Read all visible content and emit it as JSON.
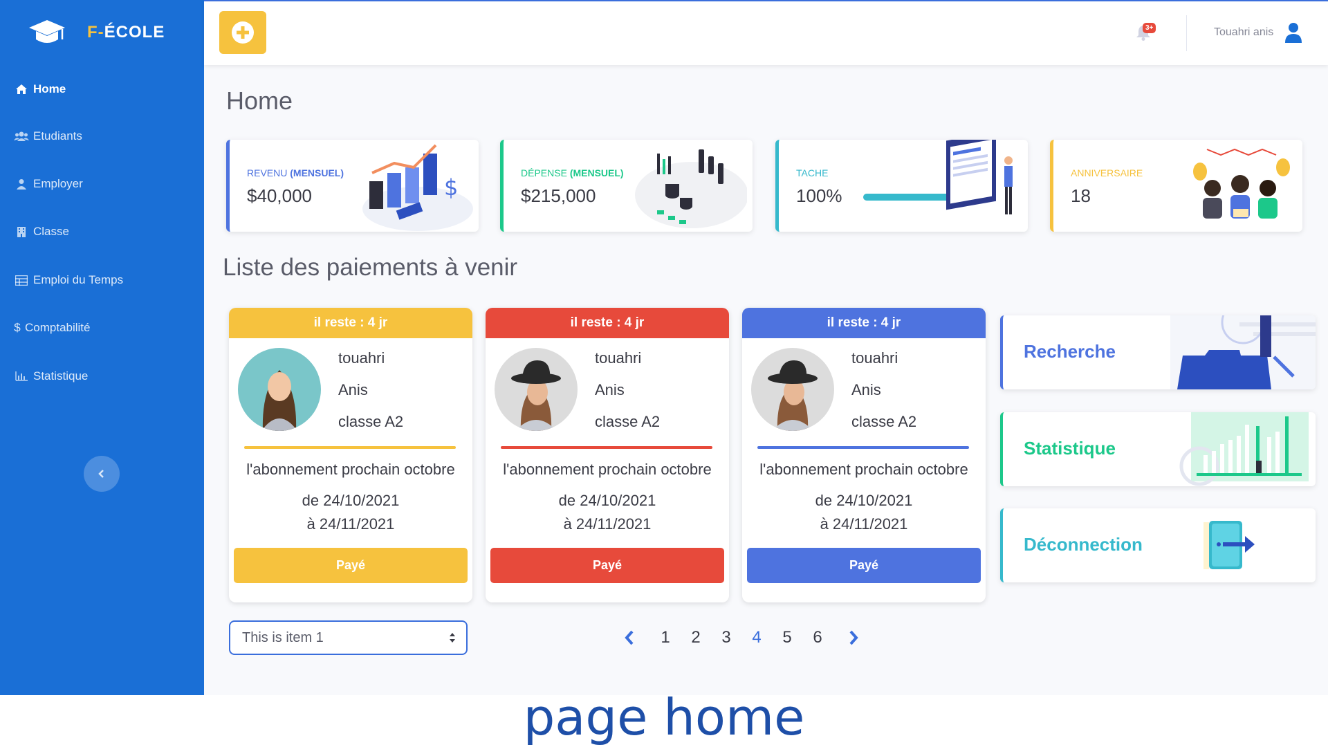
{
  "brand": {
    "prefix": "F-",
    "name": "ÉCOLE"
  },
  "sidebar": {
    "items": [
      {
        "label": "Home",
        "icon": "home-icon",
        "active": true
      },
      {
        "label": "Etudiants",
        "icon": "users-icon"
      },
      {
        "label": "Employer",
        "icon": "user-icon"
      },
      {
        "label": "Classe",
        "icon": "building-icon"
      },
      {
        "label": "Emploi du Temps",
        "icon": "table-icon"
      },
      {
        "label": "Comptabilité",
        "icon": "dollar-icon"
      },
      {
        "label": "Statistique",
        "icon": "chart-icon"
      }
    ]
  },
  "topbar": {
    "notifications_badge": "3+",
    "username": "Touahri anis"
  },
  "page": {
    "title": "Home",
    "section_title": "Liste des paiements à venir"
  },
  "stats": [
    {
      "label": "REVENU",
      "label_bold": "(MENSUEL)",
      "value": "$40,000",
      "color": "#4e73df"
    },
    {
      "label": "DÉPENSE",
      "label_bold": "(MENSUEL)",
      "value": "$215,000",
      "color": "#1cc88a"
    },
    {
      "label": "TACHE",
      "label_bold": "",
      "value": "100%",
      "progress": 1.0,
      "color": "#36b9cc"
    },
    {
      "label": "ANNIVERSAIRE",
      "label_bold": "",
      "value": "18",
      "color": "#f6c23e"
    }
  ],
  "payments": [
    {
      "remaining": "il reste : 4 jr",
      "first": "touahri",
      "last": "Anis",
      "class": "classe A2",
      "sub": "l'abonnement prochain octobre",
      "from": "de 24/10/2021",
      "to": "à 24/11/2021",
      "button": "Payé",
      "color": "#f6c23e"
    },
    {
      "remaining": "il reste : 4 jr",
      "first": "touahri",
      "last": "Anis",
      "class": "classe A2",
      "sub": "l'abonnement prochain octobre",
      "from": "de 24/10/2021",
      "to": "à 24/11/2021",
      "button": "Payé",
      "color": "#e74a3b"
    },
    {
      "remaining": "il reste : 4 jr",
      "first": "touahri",
      "last": "Anis",
      "class": "classe A2",
      "sub": "l'abonnement prochain octobre",
      "from": "de 24/10/2021",
      "to": "à 24/11/2021",
      "button": "Payé",
      "color": "#4e73df"
    }
  ],
  "shortcuts": [
    {
      "label": "Recherche",
      "color": "#4e73df"
    },
    {
      "label": "Statistique",
      "color": "#1cc88a"
    },
    {
      "label": "Déconnection",
      "color": "#36b9cc"
    }
  ],
  "select": {
    "value": "This is item 1"
  },
  "pagination": {
    "pages": [
      "1",
      "2",
      "3",
      "4",
      "5",
      "6"
    ],
    "current": "4"
  },
  "caption": "page home"
}
